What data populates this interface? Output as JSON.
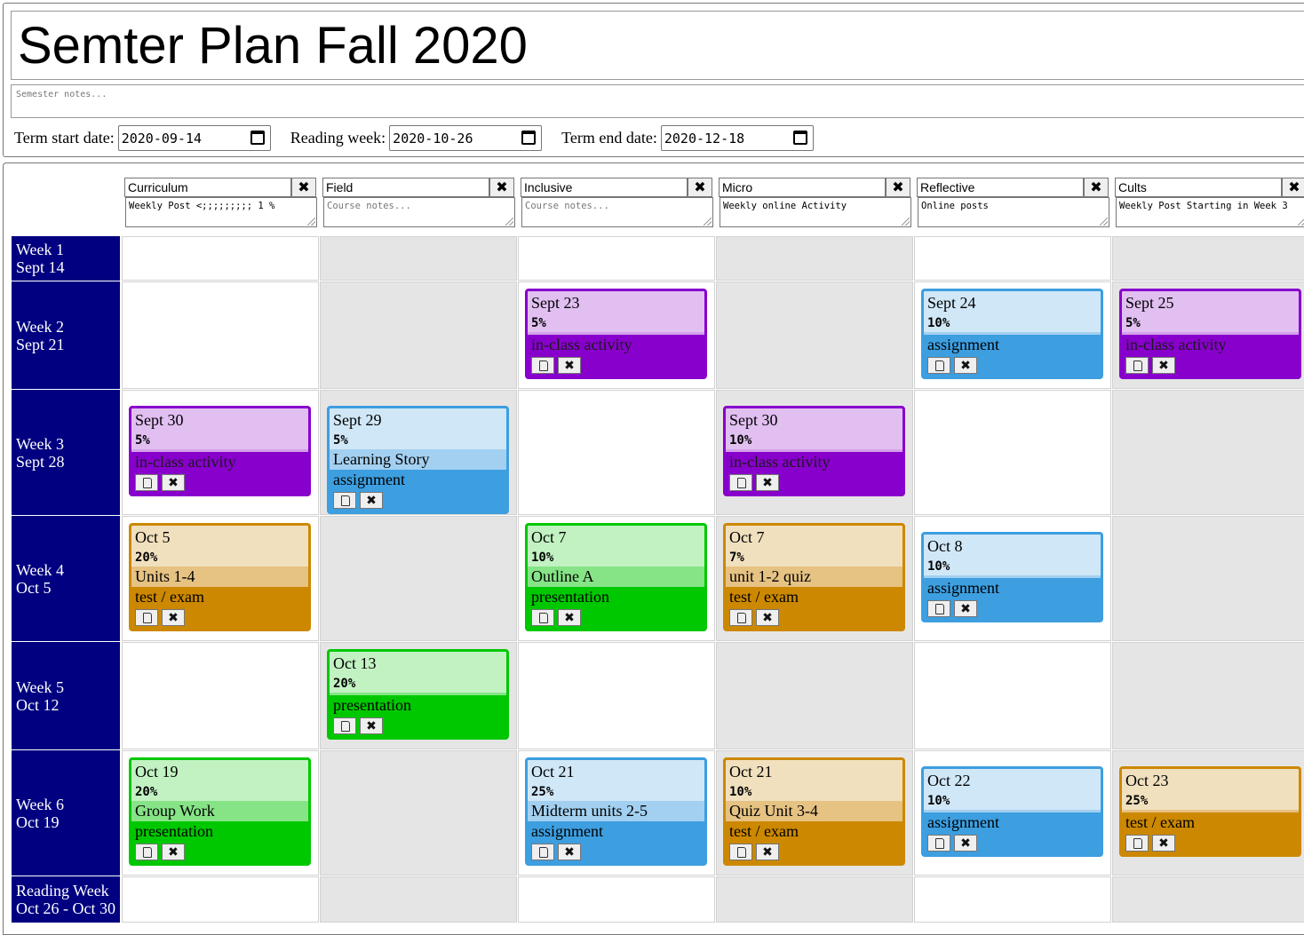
{
  "plan_title": "Semter Plan Fall 2020",
  "semester_notes_placeholder": "Semester notes...",
  "dates": {
    "term_start_label": "Term start date:",
    "term_start_value": "2020-09-14",
    "reading_week_label": "Reading week:",
    "reading_week_value": "2020-10-26",
    "term_end_label": "Term end date:",
    "term_end_value": "2020-12-18"
  },
  "close_symbol": "✖",
  "courses": [
    {
      "name": "Curriculum",
      "notes": "Weekly Post <;;;;;;;;; 1 %",
      "placeholder": false
    },
    {
      "name": "Field",
      "notes": "Course notes...",
      "placeholder": true
    },
    {
      "name": "Inclusive",
      "notes": "Course notes...",
      "placeholder": true
    },
    {
      "name": "Micro",
      "notes": "Weekly online Activity",
      "placeholder": false
    },
    {
      "name": "Reflective",
      "notes": "Online posts",
      "placeholder": false
    },
    {
      "name": "Cults",
      "notes": "Weekly Post Starting in Week 3",
      "placeholder": false
    }
  ],
  "weeks": [
    {
      "line1": "Week 1",
      "line2": "Sept 14"
    },
    {
      "line1": "Week 2",
      "line2": "Sept 21"
    },
    {
      "line1": "Week 3",
      "line2": "Sept 28"
    },
    {
      "line1": "Week 4",
      "line2": "Oct 5"
    },
    {
      "line1": "Week 5",
      "line2": "Oct 12"
    },
    {
      "line1": "Week 6",
      "line2": "Oct 19"
    },
    {
      "line1": "Reading Week",
      "line2": "Oct 26 - Oct 30"
    }
  ],
  "assignments": [
    {
      "week": 1,
      "course": 2,
      "date": "Sept 23",
      "pct": "5%",
      "title": "",
      "type": "in-class activity",
      "color": "purple"
    },
    {
      "week": 1,
      "course": 4,
      "date": "Sept 24",
      "pct": "10%",
      "title": "",
      "type": "assignment",
      "color": "blue"
    },
    {
      "week": 1,
      "course": 5,
      "date": "Sept 25",
      "pct": "5%",
      "title": "",
      "type": "in-class activity",
      "color": "purple"
    },
    {
      "week": 2,
      "course": 0,
      "date": "Sept 30",
      "pct": "5%",
      "title": "",
      "type": "in-class activity",
      "color": "purple"
    },
    {
      "week": 2,
      "course": 1,
      "date": "Sept 29",
      "pct": "5%",
      "title": "Learning Story",
      "type": "assignment",
      "color": "blue"
    },
    {
      "week": 2,
      "course": 3,
      "date": "Sept 30",
      "pct": "10%",
      "title": "",
      "type": "in-class activity",
      "color": "purple"
    },
    {
      "week": 3,
      "course": 0,
      "date": "Oct 5",
      "pct": "20%",
      "title": "Units 1-4",
      "type": "test / exam",
      "color": "orange"
    },
    {
      "week": 3,
      "course": 2,
      "date": "Oct 7",
      "pct": "10%",
      "title": "Outline A",
      "type": "presentation",
      "color": "green"
    },
    {
      "week": 3,
      "course": 3,
      "date": "Oct 7",
      "pct": "7%",
      "title": "unit 1-2 quiz",
      "type": "test / exam",
      "color": "orange"
    },
    {
      "week": 3,
      "course": 4,
      "date": "Oct 8",
      "pct": "10%",
      "title": "",
      "type": "assignment",
      "color": "blue"
    },
    {
      "week": 4,
      "course": 1,
      "date": "Oct 13",
      "pct": "20%",
      "title": "",
      "type": "presentation",
      "color": "green"
    },
    {
      "week": 5,
      "course": 0,
      "date": "Oct 19",
      "pct": "20%",
      "title": "Group Work",
      "type": "presentation",
      "color": "green"
    },
    {
      "week": 5,
      "course": 2,
      "date": "Oct 21",
      "pct": "25%",
      "title": "Midterm units 2-5",
      "type": "assignment",
      "color": "blue"
    },
    {
      "week": 5,
      "course": 3,
      "date": "Oct 21",
      "pct": "10%",
      "title": "Quiz Unit 3-4",
      "type": "test / exam",
      "color": "orange"
    },
    {
      "week": 5,
      "course": 4,
      "date": "Oct 22",
      "pct": "10%",
      "title": "",
      "type": "assignment",
      "color": "blue"
    },
    {
      "week": 5,
      "course": 5,
      "date": "Oct 23",
      "pct": "25%",
      "title": "",
      "type": "test / exam",
      "color": "orange"
    }
  ]
}
